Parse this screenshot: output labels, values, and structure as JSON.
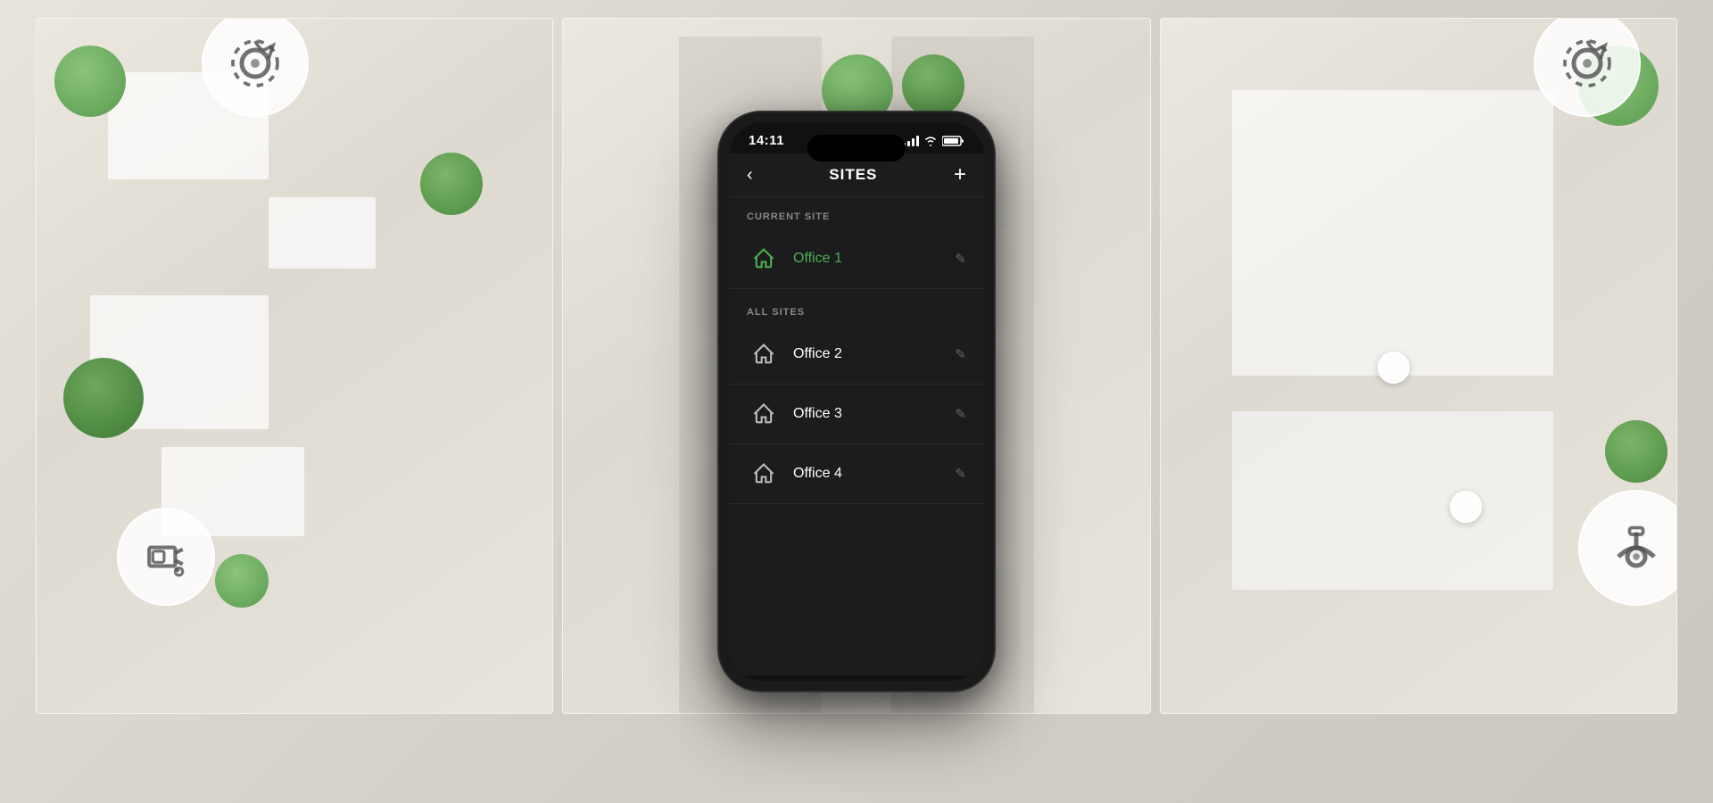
{
  "background": {
    "color": "#d8d5cc"
  },
  "phone": {
    "status_bar": {
      "time": "14:11",
      "signal": "●●●",
      "wifi": "wifi",
      "battery": "battery"
    },
    "nav": {
      "back_label": "‹",
      "title": "SITES",
      "add_label": "+"
    },
    "current_site_section": {
      "label": "CURRENT SITE"
    },
    "current_site": {
      "name": "Office 1",
      "icon": "home"
    },
    "all_sites_section": {
      "label": "ALL SITES"
    },
    "sites": [
      {
        "name": "Office 2",
        "icon": "home"
      },
      {
        "name": "Office 3",
        "icon": "home"
      },
      {
        "name": "Office 4",
        "icon": "home"
      }
    ]
  },
  "cameras": {
    "top_left": "dome-camera",
    "bottom_left": "box-camera",
    "top_right": "dome-camera",
    "bottom_right": "dome-camera-inverted"
  }
}
